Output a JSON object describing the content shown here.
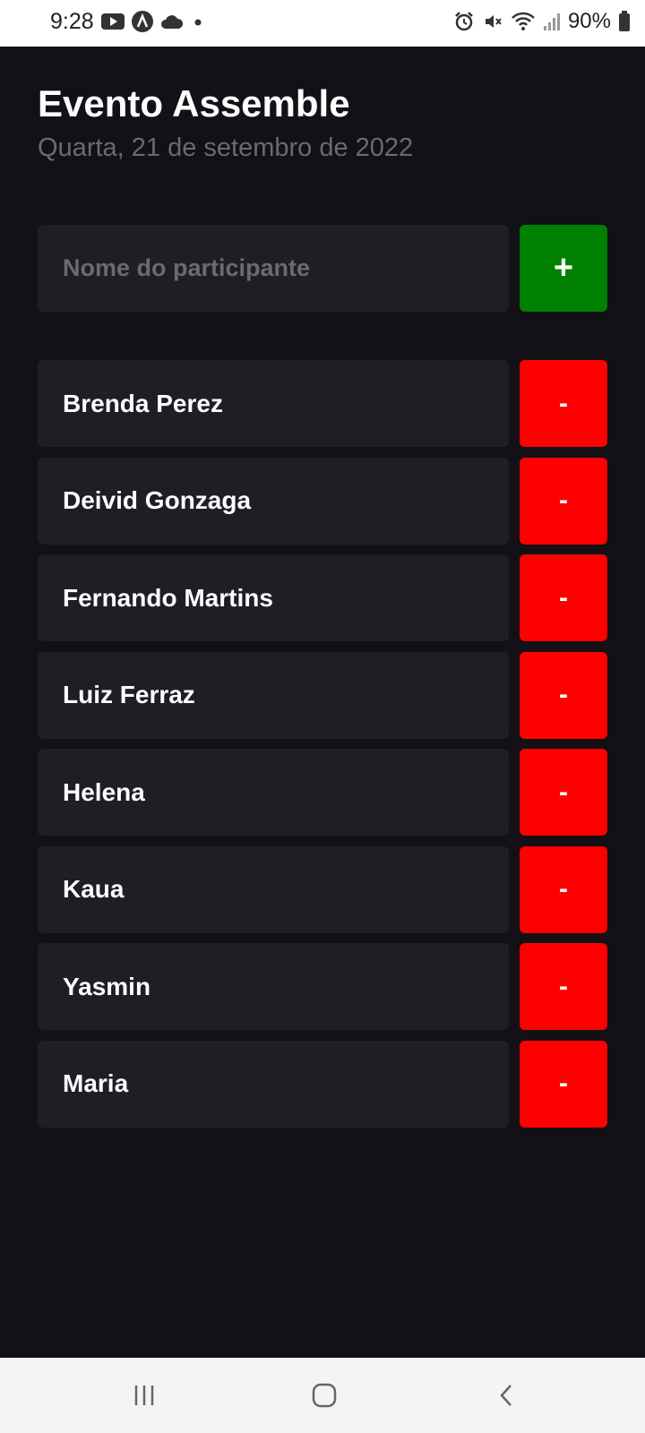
{
  "status_bar": {
    "time": "9:28",
    "battery": "90%",
    "left_icons": [
      "youtube-icon",
      "a-logo-icon",
      "cloud-icon",
      "dot-icon"
    ],
    "right_icons": [
      "alarm-icon",
      "vibrate-icon",
      "wifi-icon",
      "signal-icon",
      "battery-icon"
    ]
  },
  "app": {
    "title": "Evento Assemble",
    "subtitle": "Quarta, 21 de setembro de 2022",
    "input_placeholder": "Nome do participante",
    "add_label": "+",
    "remove_label": "-",
    "participants": [
      "Brenda Perez",
      "Deivid Gonzaga",
      "Fernando Martins",
      "Luiz Ferraz",
      "Helena",
      "Kaua",
      "Yasmin",
      "Maria"
    ]
  },
  "colors": {
    "background": "#131016",
    "card": "#1F1E25",
    "text": "#FDFCFE",
    "muted": "#6B6B6B",
    "add": "#008000",
    "remove": "#FF0000"
  },
  "nav": [
    "recent-apps-icon",
    "home-icon",
    "back-icon"
  ]
}
